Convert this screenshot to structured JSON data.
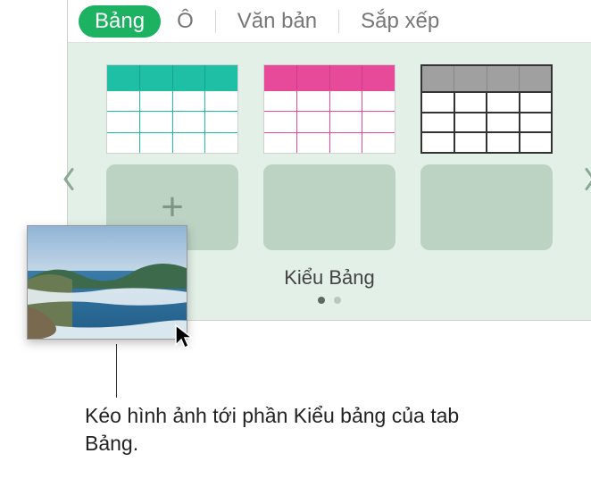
{
  "tabs": {
    "bang": "Bảng",
    "o": "Ô",
    "vanban": "Văn bản",
    "sapxep": "Sắp xếp"
  },
  "section_label": "Kiểu Bảng",
  "caption": "Kéo hình ảnh tới phần Kiểu bảng của tab Bảng."
}
